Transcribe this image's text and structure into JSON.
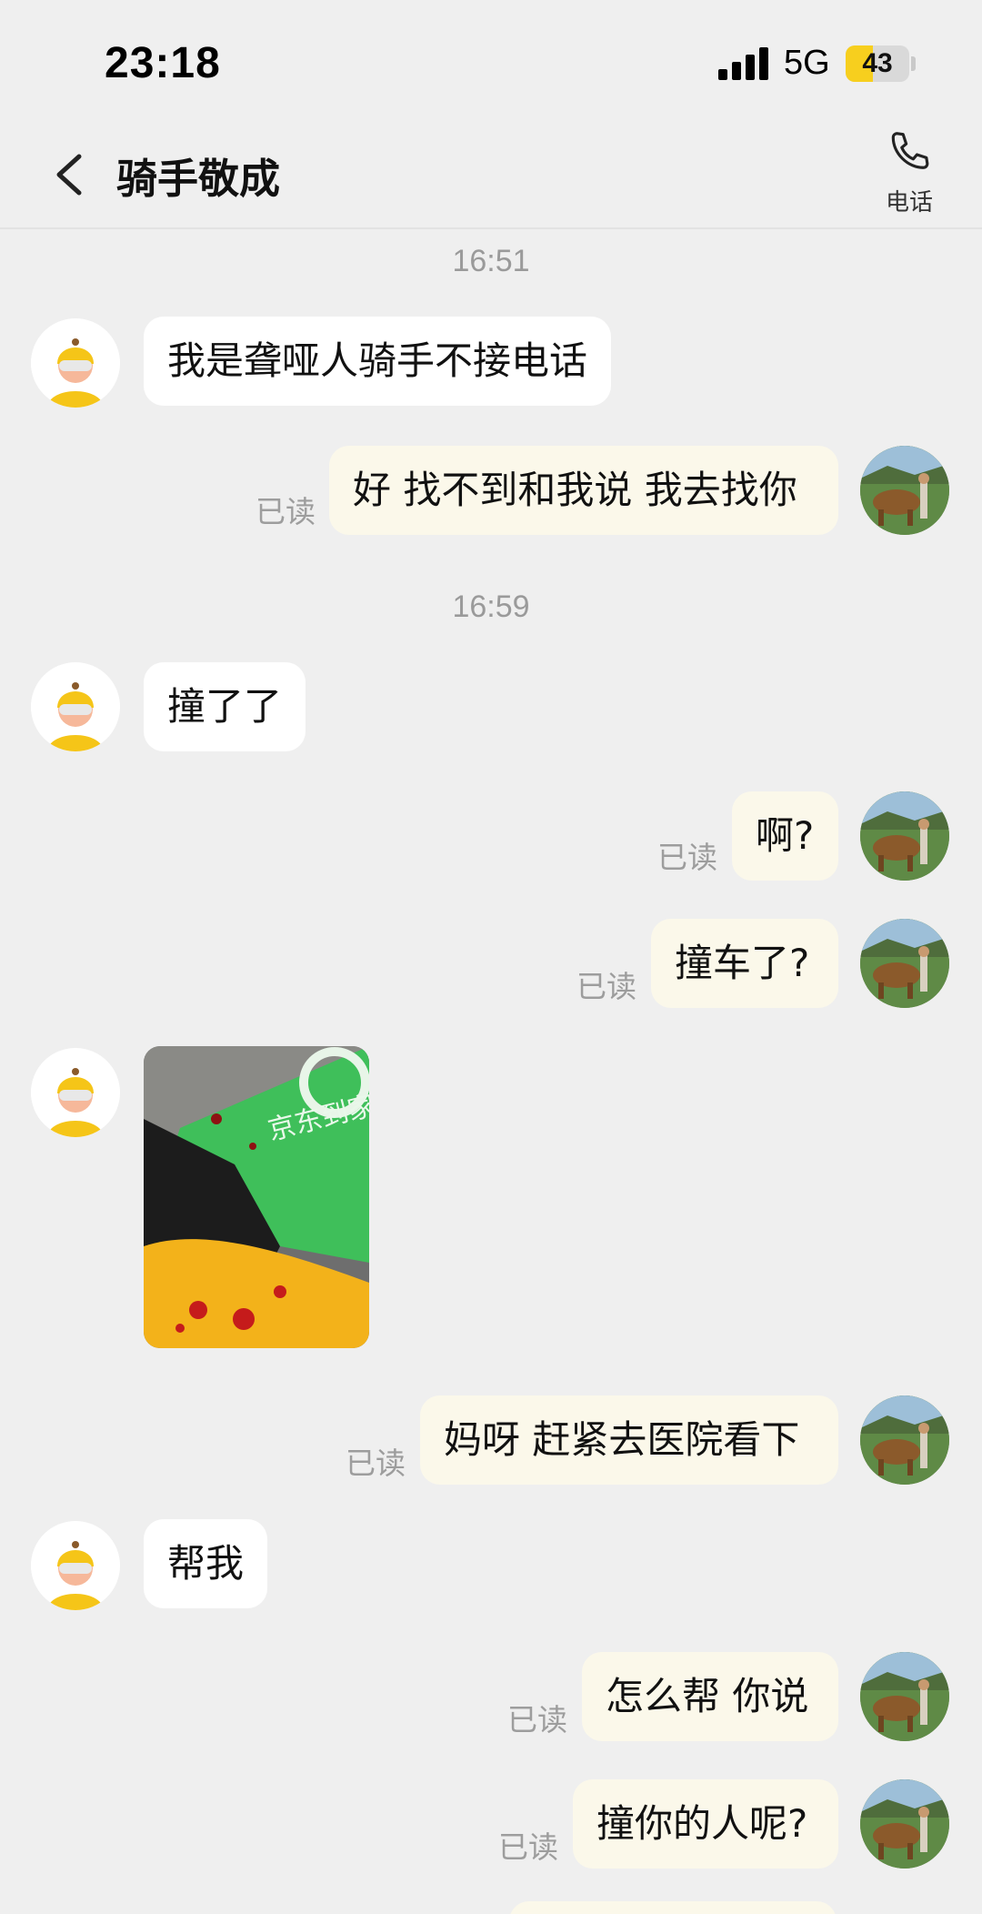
{
  "status_bar": {
    "time": "23:18",
    "network": "5G",
    "battery": "43",
    "battery_level": 0.43
  },
  "header": {
    "title": "骑手敬成",
    "call_label": "电话"
  },
  "icons": {
    "back": "chevron-left-icon",
    "phone": "phone-icon"
  },
  "colors": {
    "background": "#efefef",
    "incoming_bubble": "#ffffff",
    "outgoing_bubble": "#fbf8ea",
    "accent": "#f7cf1e",
    "read_text": "#9d9d9d"
  },
  "timestamps": [
    "16:51",
    "16:59"
  ],
  "read_label": "已读",
  "messages": [
    {
      "from": "rider",
      "text": "我是聋哑人骑手不接电话"
    },
    {
      "from": "me",
      "text": "好 找不到和我说 我去找你",
      "status": "已读"
    },
    {
      "from": "rider",
      "text": "撞了了"
    },
    {
      "from": "me",
      "text": "啊?",
      "status": "已读"
    },
    {
      "from": "me",
      "text": "撞车了?",
      "status": "已读"
    },
    {
      "from": "rider",
      "type": "image",
      "text": "京东到家"
    },
    {
      "from": "me",
      "text": "妈呀 赶紧去医院看下",
      "status": "已读"
    },
    {
      "from": "rider",
      "text": "帮我"
    },
    {
      "from": "me",
      "text": "怎么帮 你说",
      "status": "已读"
    },
    {
      "from": "me",
      "text": "撞你的人呢?",
      "status": "已读"
    }
  ]
}
